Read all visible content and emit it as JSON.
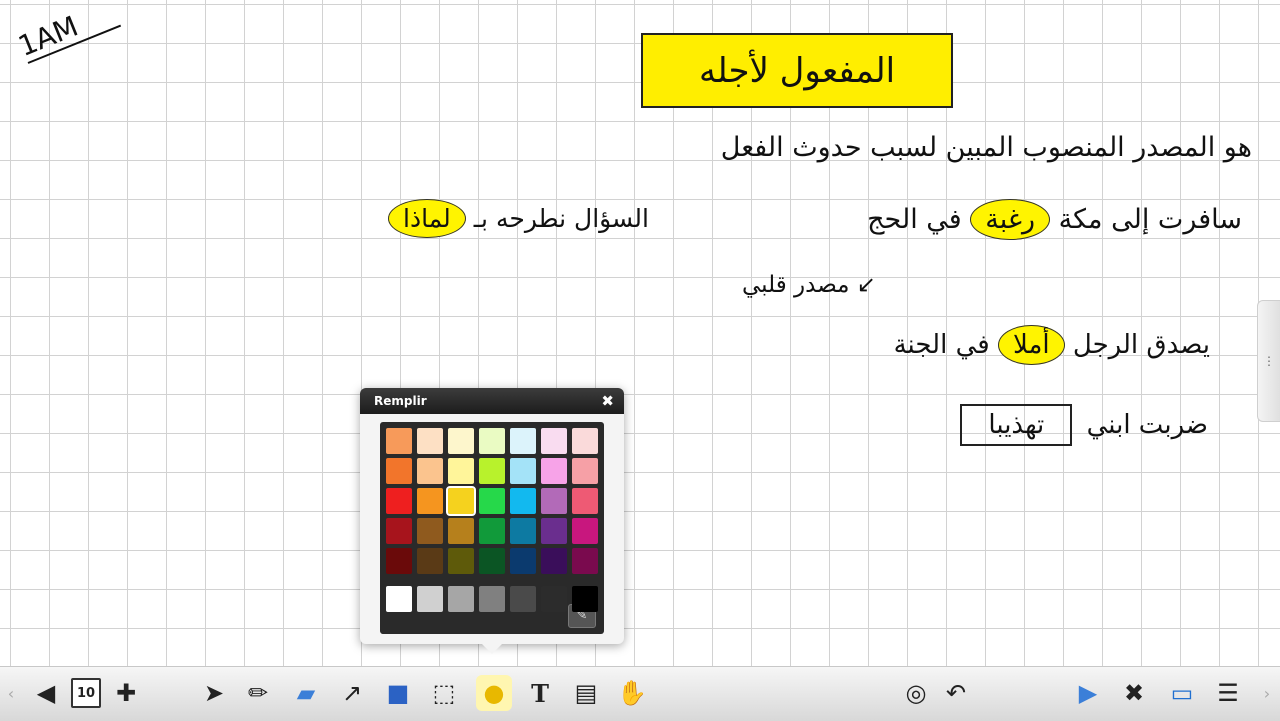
{
  "canvas": {
    "corner_note": "1AM",
    "title": "المفعول لأجله",
    "definition": "هو المصدر المنصوب المبين لسبب حدوث الفعل",
    "example1": {
      "before": "سافرت إلى مكة",
      "highlight": "رغبة",
      "after": "في الحج"
    },
    "question": {
      "text": "السؤال نطرحه بـ",
      "highlight": "لماذا"
    },
    "note": "مصدر قلبي",
    "example2": {
      "before": "يصدق الرجل",
      "highlight": "أملا",
      "after": "في الجنة"
    },
    "example3": {
      "before": "ضربت ابني",
      "boxed": "تهذيبا"
    }
  },
  "fill_popup": {
    "title": "Remplir",
    "close": "✖",
    "colors": [
      [
        "#f79a5a",
        "#fde0c4",
        "#fdf6cc",
        "#eafbc3",
        "#dcf3fb",
        "#f9dcf0",
        "#fadada"
      ],
      [
        "#f2752b",
        "#fbc48e",
        "#fff59a",
        "#b8f22c",
        "#a4e3f8",
        "#f7a3e8",
        "#f6a0a6"
      ],
      [
        "#ee1f1f",
        "#f5951f",
        "#f5d21e",
        "#26d84a",
        "#12b9ef",
        "#b26ab8",
        "#ee5a74"
      ],
      [
        "#a7141c",
        "#8f5a1e",
        "#b6801c",
        "#119a3a",
        "#0d7aa2",
        "#6a2e8e",
        "#c8177e"
      ],
      [
        "#6a0a0a",
        "#5a3a16",
        "#5e5a0a",
        "#0b5524",
        "#0b3a6e",
        "#3a0e5a",
        "#7a0a4e"
      ],
      [
        "#ffffff",
        "#d0d0d0",
        "#a6a6a6",
        "#808080",
        "#4a4a4a",
        "#2c2c2c",
        "#000000"
      ]
    ],
    "selected": "#f5d21e",
    "eyedropper_icon": "eyedropper-icon"
  },
  "toolbar": {
    "page_number": "10",
    "left_tools": [
      "prev-page",
      "page-sorter",
      "add-page"
    ],
    "draw_tools": [
      "select",
      "pen",
      "eraser",
      "line",
      "shape",
      "3d-shape",
      "fill",
      "text",
      "capture",
      "gestures"
    ],
    "right_tools": [
      "magic-pen",
      "undo",
      "screen-share",
      "tools",
      "display",
      "menu"
    ],
    "active_tool": "fill"
  }
}
